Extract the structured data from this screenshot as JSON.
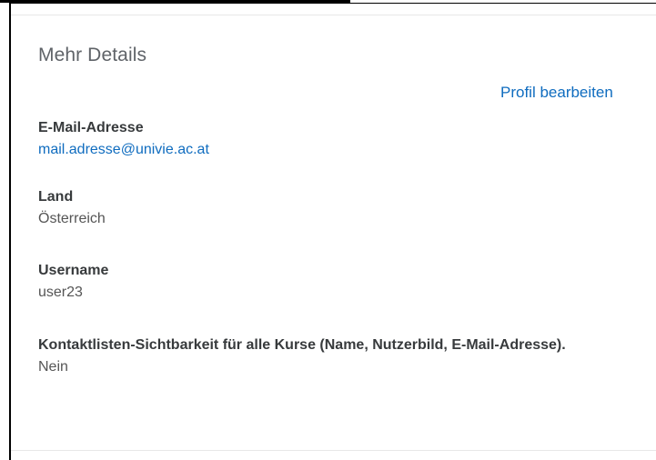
{
  "card": {
    "title": "Mehr Details",
    "edit_link_label": "Profil bearbeiten"
  },
  "fields": {
    "email": {
      "label": "E-Mail-Adresse",
      "value": "mail.adresse@univie.ac.at"
    },
    "country": {
      "label": "Land",
      "value": "Österreich"
    },
    "username": {
      "label": "Username",
      "value": "user23"
    },
    "visibility": {
      "label": "Kontaktlisten-Sichtbarkeit für alle Kurse (Name, Nutzerbild, E-Mail-Adresse).",
      "value": "Nein"
    }
  },
  "colors": {
    "link": "#0f6cbf",
    "label": "#373a3c",
    "value": "#555555",
    "title": "#5f6368"
  }
}
